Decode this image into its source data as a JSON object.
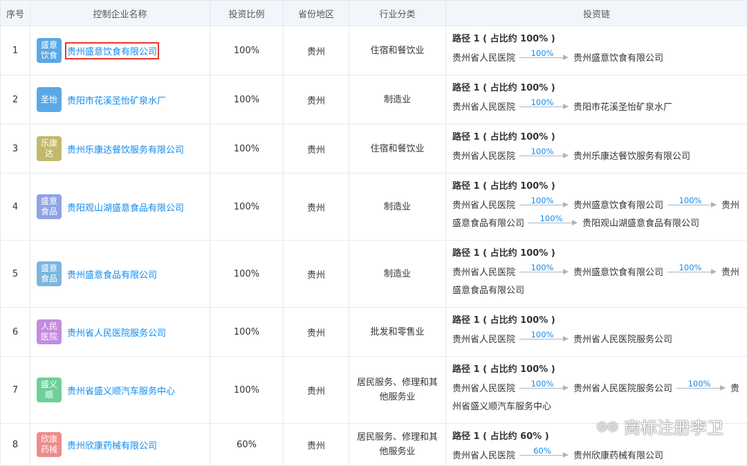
{
  "headers": {
    "index": "序号",
    "name": "控制企业名称",
    "ratio": "投资比例",
    "region": "省份地区",
    "industry": "行业分类",
    "chain": "投资链"
  },
  "colors": {
    "link": "#128bed",
    "highlight": "#e8352c",
    "header_bg": "#f2f6fb"
  },
  "rows": [
    {
      "index": "1",
      "logo": "盛意饮食",
      "logo_color": "#5aa8e6",
      "name": "贵州盛意饮食有限公司",
      "ratio": "100%",
      "region": "贵州",
      "industry": "住宿和餐饮业",
      "path_title": "路径 1 ( 占比约 100% )",
      "lines": [
        [
          "贵州省人民医院",
          "100%",
          "贵州盛意饮食有限公司"
        ]
      ]
    },
    {
      "index": "2",
      "logo": "圣怡",
      "logo_color": "#5aa8e6",
      "name": "贵阳市花溪圣怡矿泉水厂",
      "ratio": "100%",
      "region": "贵州",
      "industry": "制造业",
      "path_title": "路径 1 ( 占比约 100% )",
      "lines": [
        [
          "贵州省人民医院",
          "100%",
          "贵阳市花溪圣怡矿泉水厂"
        ]
      ]
    },
    {
      "index": "3",
      "logo": "乐康达",
      "logo_color": "#c3b96a",
      "name": "贵州乐康达餐饮服务有限公司",
      "ratio": "100%",
      "region": "贵州",
      "industry": "住宿和餐饮业",
      "path_title": "路径 1 ( 占比约 100% )",
      "lines": [
        [
          "贵州省人民医院",
          "100%",
          "贵州乐康达餐饮服务有限公司"
        ]
      ]
    },
    {
      "index": "4",
      "logo": "盛意食品",
      "logo_color": "#8ea4e6",
      "name": "贵阳观山湖盛意食品有限公司",
      "ratio": "100%",
      "region": "贵州",
      "industry": "制造业",
      "path_title": "路径 1 ( 占比约 100% )",
      "lines": [
        [
          "贵州省人民医院",
          "100%",
          "贵州盛意饮食有限公司",
          "100%",
          "贵州"
        ],
        [
          "盛意食品有限公司",
          "100%",
          "贵阳观山湖盛意食品有限公司"
        ]
      ]
    },
    {
      "index": "5",
      "logo": "盛意食品",
      "logo_color": "#7ab6e0",
      "name": "贵州盛意食品有限公司",
      "ratio": "100%",
      "region": "贵州",
      "industry": "制造业",
      "path_title": "路径 1 ( 占比约 100% )",
      "lines": [
        [
          "贵州省人民医院",
          "100%",
          "贵州盛意饮食有限公司",
          "100%",
          "贵州"
        ],
        [
          "盛意食品有限公司"
        ]
      ]
    },
    {
      "index": "6",
      "logo": "人民医院",
      "logo_color": "#c48be0",
      "name": "贵州省人民医院服务公司",
      "ratio": "100%",
      "region": "贵州",
      "industry": "批发和零售业",
      "path_title": "路径 1 ( 占比约 100% )",
      "lines": [
        [
          "贵州省人民医院",
          "100%",
          "贵州省人民医院服务公司"
        ]
      ]
    },
    {
      "index": "7",
      "logo": "盛义顺",
      "logo_color": "#6fcf9a",
      "name": "贵州省盛义顺汽车服务中心",
      "ratio": "100%",
      "region": "贵州",
      "industry": "居民服务、修理和其他服务业",
      "path_title": "路径 1 ( 占比约 100% )",
      "lines": [
        [
          "贵州省人民医院",
          "100%",
          "贵州省人民医院服务公司",
          "100%",
          "贵"
        ],
        [
          "州省盛义顺汽车服务中心"
        ]
      ]
    },
    {
      "index": "8",
      "logo": "欣康药械",
      "logo_color": "#ee8b8b",
      "name": "贵州欣康药械有限公司",
      "ratio": "60%",
      "region": "贵州",
      "industry": "居民服务、修理和其他服务业",
      "path_title": "路径 1 ( 占比约 60% )",
      "lines": [
        [
          "贵州省人民医院",
          "60%",
          "贵州欣康药械有限公司"
        ]
      ]
    }
  ],
  "watermark": {
    "icon": "wechat-icon",
    "text": "商标注册李卫"
  }
}
